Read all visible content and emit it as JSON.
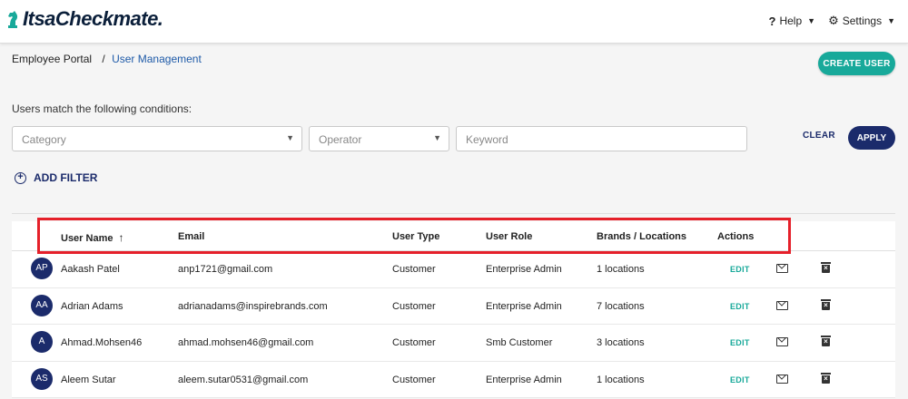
{
  "app": {
    "logo_text": "ItsaCheckmate."
  },
  "topbar": {
    "help_label": "Help",
    "settings_label": "Settings"
  },
  "breadcrumb": {
    "root": "Employee Portal",
    "separator": "/",
    "current": "User Management"
  },
  "actions": {
    "create_user_label": "CREATE USER"
  },
  "filters": {
    "conditions_label": "Users match the following conditions:",
    "category_placeholder": "Category",
    "operator_placeholder": "Operator",
    "keyword_placeholder": "Keyword",
    "clear_label": "CLEAR",
    "apply_label": "APPLY",
    "add_filter_label": "ADD FILTER"
  },
  "table": {
    "headers": {
      "user_name": "User Name",
      "email": "Email",
      "user_type": "User Type",
      "user_role": "User Role",
      "brands_locations": "Brands / Locations",
      "actions": "Actions"
    },
    "edit_label": "EDIT",
    "rows": [
      {
        "initials": "AP",
        "name": "Aakash Patel",
        "email": "anp1721@gmail.com",
        "type": "Customer",
        "role": "Enterprise Admin",
        "locations": "1 locations"
      },
      {
        "initials": "AA",
        "name": "Adrian Adams",
        "email": "adrianadams@inspirebrands.com",
        "type": "Customer",
        "role": "Enterprise Admin",
        "locations": "7 locations"
      },
      {
        "initials": "A",
        "name": "Ahmad.Mohsen46",
        "email": "ahmad.mohsen46@gmail.com",
        "type": "Customer",
        "role": "Smb Customer",
        "locations": "3 locations"
      },
      {
        "initials": "AS",
        "name": "Aleem Sutar",
        "email": "aleem.sutar0531@gmail.com",
        "type": "Customer",
        "role": "Enterprise Admin",
        "locations": "1 locations"
      }
    ]
  },
  "colors": {
    "primary_navy": "#1b2b6b",
    "accent_teal": "#18a99a",
    "highlight_red": "#e5202a"
  }
}
